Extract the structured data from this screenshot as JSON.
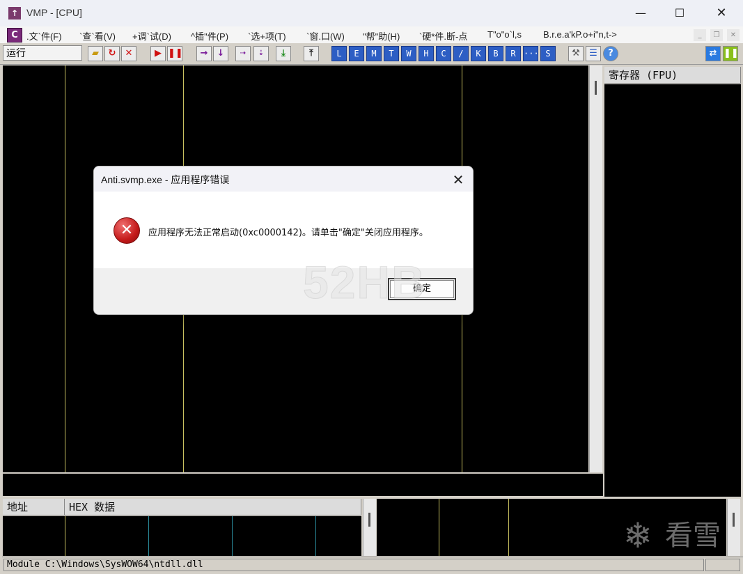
{
  "window": {
    "title": "VMP - [CPU]",
    "app_icon_glyph": "↑",
    "min_glyph": "—",
    "max_glyph": "☐",
    "close_glyph": "✕"
  },
  "menubar": {
    "app_icon_glyph": "C",
    "items": [
      ".文`件(F)",
      "`查`看(V)",
      "+调`试(D)",
      "^插\"件(P)",
      "`选+项(T)",
      "`窗.口(W)",
      "\"帮\"助(H)",
      "`硬*件.断-点",
      "T\"o\"o`l,s",
      "B.r.e.a'kP.o+i\"n,t->"
    ],
    "mdi_min": "_",
    "mdi_restore": "❐",
    "mdi_close": "✕"
  },
  "toolbar": {
    "status": "运行",
    "letters": [
      "L",
      "E",
      "M",
      "T",
      "W",
      "H",
      "C",
      "/",
      "K",
      "B",
      "R",
      "···",
      "S"
    ]
  },
  "panes": {
    "registers_header": "寄存器 (FPU)",
    "dump_addr_header": "地址",
    "dump_hex_header": "HEX 数据"
  },
  "statusbar": {
    "text": "Module C:\\Windows\\SysWOW64\\ntdll.dll"
  },
  "dialog": {
    "title": "Anti.svmp.exe - 应用程序错误",
    "close_glyph": "✕",
    "message": "应用程序无法正常启动(0xc0000142)。请单击\"确定\"关闭应用程序。",
    "ok_label": "确定",
    "error_glyph": "✕"
  },
  "watermarks": {
    "site": "52HB",
    "kanxue_snow": "❄",
    "kanxue_text": "看雪"
  },
  "colors": {
    "pane_bg": "#000000",
    "column_line": "#c8c060",
    "letter_button": "#2d5ec4"
  }
}
